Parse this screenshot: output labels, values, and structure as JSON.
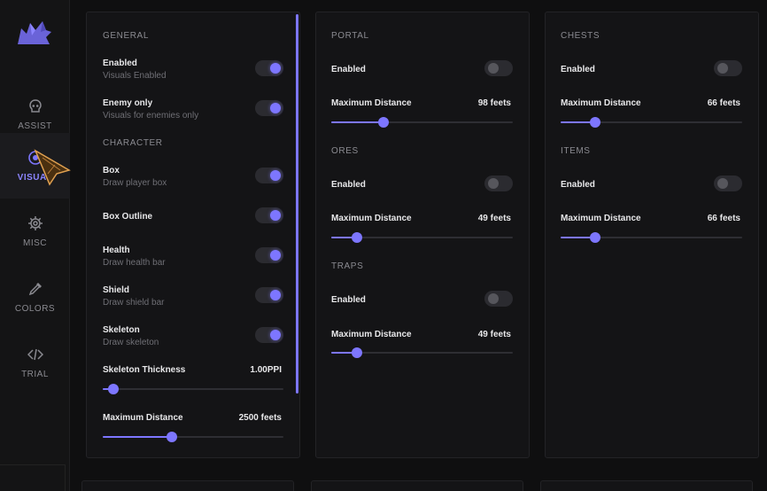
{
  "colors": {
    "accent": "#7d76ff",
    "background": "#0f0f10",
    "panel": "#141416"
  },
  "sidebar": {
    "logo_icon": "wolf-logo-icon",
    "items": [
      {
        "label": "ASSIST",
        "icon": "skull-icon",
        "active": false
      },
      {
        "label": "VISUAL",
        "icon": "eye-icon",
        "active": true
      },
      {
        "label": "MISC",
        "icon": "gear-icon",
        "active": false
      },
      {
        "label": "COLORS",
        "icon": "eyedropper-icon",
        "active": false
      },
      {
        "label": "TRIAL",
        "icon": "code-icon",
        "active": false
      }
    ]
  },
  "general": {
    "title": "GENERAL",
    "enabled": {
      "label": "Enabled",
      "sub": "Visuals Enabled",
      "on": true
    },
    "enemy_only": {
      "label": "Enemy only",
      "sub": "Visuals for enemies only",
      "on": true
    }
  },
  "character": {
    "title": "CHARACTER",
    "box": {
      "label": "Box",
      "sub": "Draw player box",
      "on": true
    },
    "box_outline": {
      "label": "Box Outline",
      "on": true
    },
    "health": {
      "label": "Health",
      "sub": "Draw health bar",
      "on": true
    },
    "shield": {
      "label": "Shield",
      "sub": "Draw shield bar",
      "on": true
    },
    "skeleton": {
      "label": "Skeleton",
      "sub": "Draw skeleton",
      "on": true
    },
    "skeleton_thickness": {
      "label": "Skeleton Thickness",
      "value": "1.00PPI",
      "level": 0.06
    },
    "max_distance": {
      "label": "Maximum Distance",
      "value": "2500 feets",
      "level": 0.38
    }
  },
  "portal": {
    "title": "PORTAL",
    "enabled": {
      "label": "Enabled",
      "on": false
    },
    "max_distance": {
      "label": "Maximum Distance",
      "value": "98 feets",
      "level": 0.29
    }
  },
  "ores": {
    "title": "ORES",
    "enabled": {
      "label": "Enabled",
      "on": false
    },
    "max_distance": {
      "label": "Maximum Distance",
      "value": "49 feets",
      "level": 0.14
    }
  },
  "traps": {
    "title": "TRAPS",
    "enabled": {
      "label": "Enabled",
      "on": false
    },
    "max_distance": {
      "label": "Maximum Distance",
      "value": "49 feets",
      "level": 0.14
    }
  },
  "chests": {
    "title": "CHESTS",
    "enabled": {
      "label": "Enabled",
      "on": false
    },
    "max_distance": {
      "label": "Maximum Distance",
      "value": "66 feets",
      "level": 0.19
    }
  },
  "items": {
    "title": "ITEMS",
    "enabled": {
      "label": "Enabled",
      "on": false
    },
    "max_distance": {
      "label": "Maximum Distance",
      "value": "66 feets",
      "level": 0.19
    }
  }
}
